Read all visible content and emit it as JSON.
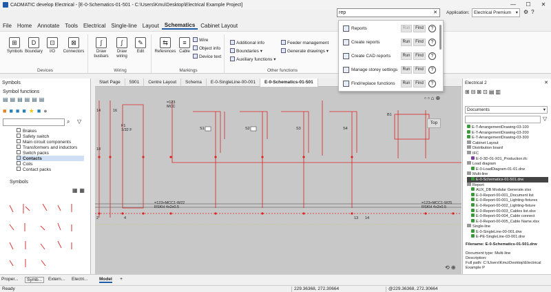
{
  "title": "CADMATIC develop Electrical - [E-0-Schematics-01-501 - C:\\Users\\Kmu\\Desktop\\Electrical Example Project]",
  "search": {
    "value": "rep"
  },
  "application_label": "Application:",
  "application_value": "Electrical Premium",
  "menu": [
    "File",
    "Home",
    "Annotate",
    "Tools",
    "Electrical",
    "Single-line",
    "Layout",
    "Schematics",
    "Cabinet Layout"
  ],
  "menu_active": "Schematics",
  "ribbon": {
    "devices": {
      "label": "Devices",
      "buttons": [
        "Symbols",
        "Boundary",
        "I/O",
        "Connectors"
      ]
    },
    "wiring": {
      "label": "Wiring",
      "buttons": [
        "Draw busbars",
        "Draw wiring",
        "Edit"
      ]
    },
    "markings": {
      "label": "Markings",
      "buttons": [
        "References",
        "Cable"
      ],
      "small": [
        "Wire",
        "Object info",
        "Device text"
      ]
    },
    "other": {
      "label": "Other functions",
      "small": [
        "Additional info",
        "Boundaries",
        "Auxiliary functions",
        "Feeder management",
        "Generate drawings"
      ]
    }
  },
  "dropdown": [
    {
      "label": "Reports",
      "run": "Run",
      "find": "Find"
    },
    {
      "label": "Create reports",
      "run": "Run",
      "find": "Find"
    },
    {
      "label": "Create CAD reports",
      "run": "Run",
      "find": "Find"
    },
    {
      "label": "Manage storey settings",
      "run": "Run",
      "find": "Find"
    },
    {
      "label": "Find/replace functions",
      "run": "Run",
      "find": "Find"
    }
  ],
  "left": {
    "symbols_header": "Symbols",
    "symbol_functions": "Symbol functions",
    "tree": [
      "Brakes",
      "Safety switch",
      "Main circuit components",
      "Transformers and inductors",
      "Switch packs",
      "Contacts",
      "Coils",
      "Contact packs"
    ],
    "tree_selected": "Contacts",
    "symbols_label": "Symbols"
  },
  "tabs": [
    "Start Page",
    "5901",
    "Centre Layout",
    "Schema",
    "E-0-SingleLine-00-001",
    "E-0-Schematics-01-501"
  ],
  "tab_active": "E-0-Schematics-01-501",
  "top_button": "Top",
  "schematic_labels": {
    "mcc": "=123\nMCC",
    "b1": "B1",
    "f1": "F1\n1/32 F",
    "s": [
      "S1",
      "S2",
      "S3",
      "S4"
    ],
    "w22": "=123+MCC1-W22\nRSKH 4x2x0.5",
    "w25": "=123+MCC1-W25\nRSKH 4x2x0.5",
    "nums_top": [
      "14",
      "16",
      "18",
      "14",
      "14",
      "14"
    ],
    "nums_bottom": [
      "2",
      "4",
      "2",
      "4",
      "13",
      "14"
    ]
  },
  "bottom_tabs": [
    "Proper...",
    "Symb...",
    "Extern...",
    "Electri..."
  ],
  "model_tab": "Model",
  "right": {
    "header": "Electrical 2",
    "documents": "Documents",
    "tree": [
      "E-T-ArrangementDrawing-03-100",
      "E-T-ArrangementDrawing-03-200",
      "E-T-ArrangementDrawing-03-300",
      "Cabinet Layout",
      "Distribution board",
      "IFC",
      "E-0-3D-01-X01_Production.ifc",
      "Load diagram",
      "E-0-LoadDiagram-01-01.drw",
      "Multi-line",
      "E-0-Schematics-01-501.drw",
      "Report",
      "AUX_DB Modular Generate.xlsx",
      "E-0-Report-00-001_Document list",
      "E-0-Report-00-001_Lighting-fixtures",
      "E-0-Report-00-002_Lighting-fixture",
      "E-0-Report-00-003_Cables list.xlsx",
      "E-0-Report-00-004_Cable connect",
      "E-0-Report-00-005_Cable Name.xlsx",
      "Single-line",
      "E-0-SingleLine-00-001.drw",
      "E-PE-SingleLine-03-001.drw"
    ],
    "tree_selected": "E-0-Schematics-01-501.drw",
    "filename": "Filename: E-0-Schematics-01-501.drw",
    "doc_type": "Document type: Multi-line",
    "description": "Description:",
    "full_path": "Full path: C:\\Users\\Kmu\\Desktop\\Electrical Example P"
  },
  "status": {
    "ready": "Ready",
    "coord1": "229.36368, 272.30664",
    "coord2": "@229.36368, 272.30664"
  }
}
